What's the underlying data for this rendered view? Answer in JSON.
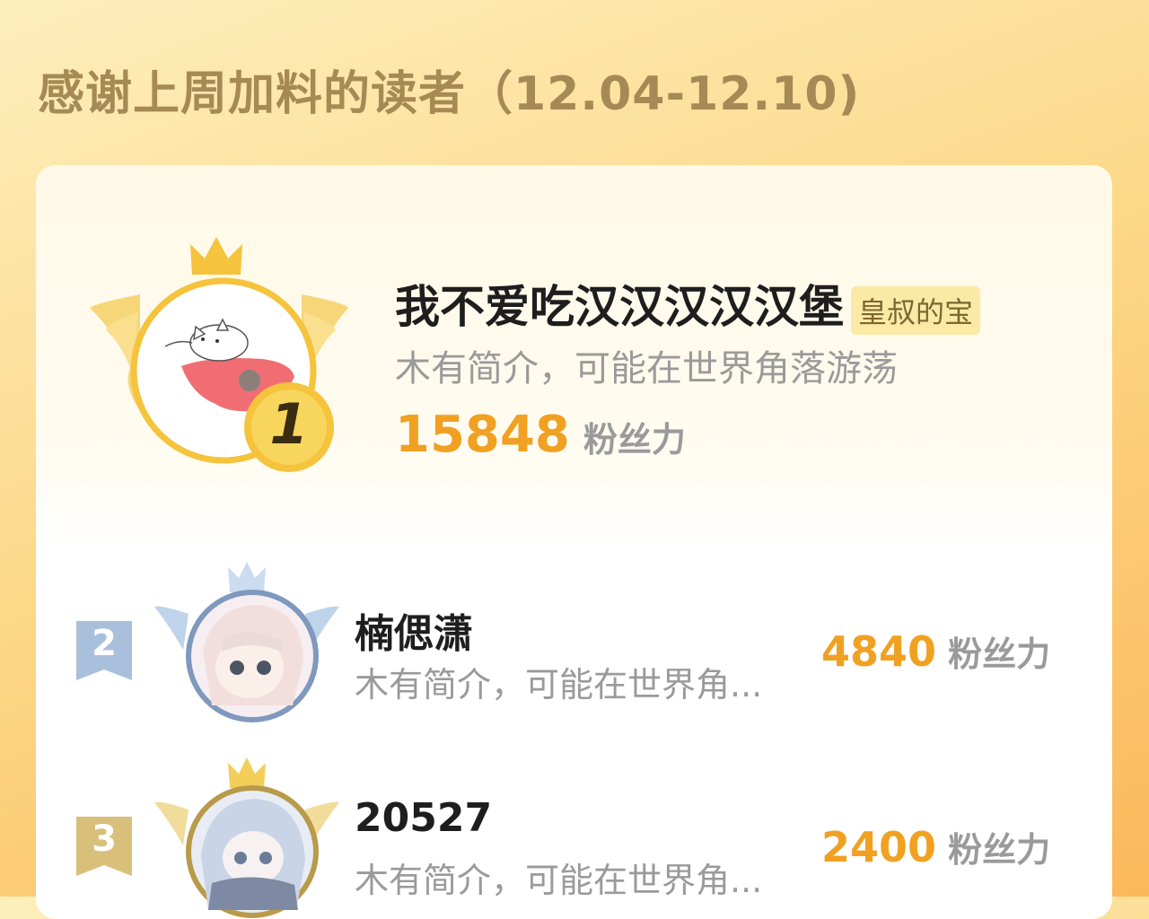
{
  "header": {
    "title": "感谢上周加料的读者（12.04-12.10)"
  },
  "colors": {
    "accent": "#f0a122",
    "title": "#a58a55",
    "gold": "#f5c33c",
    "silver": "#7f98bd",
    "bronze": "#b99a4a"
  },
  "leaderboard": {
    "unit_label": "粉丝力",
    "entries": [
      {
        "rank": "1",
        "name": "我不爱吃汉汉汉汉汉堡",
        "tag": "皇叔的宝",
        "bio": "木有简介，可能在世界角落游荡",
        "score": "15848",
        "avatar_icon": "cat-on-blanket-avatar"
      },
      {
        "rank": "2",
        "name": "楠偲潇",
        "bio": "木有简介，可能在世界角...",
        "score": "4840",
        "avatar_icon": "anime-girl-avatar"
      },
      {
        "rank": "3",
        "name": "20527",
        "bio": "木有简介，可能在世界角...",
        "score": "2400",
        "avatar_icon": "anime-girl-scarf-avatar"
      }
    ]
  }
}
